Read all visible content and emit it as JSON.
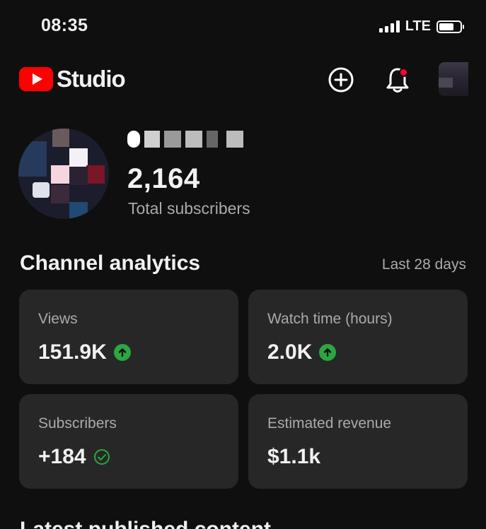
{
  "status_bar": {
    "time": "08:35",
    "network": "LTE"
  },
  "header": {
    "logo_text": "Studio",
    "icons": [
      "youtube-play-icon",
      "create-plus-icon",
      "bell-icon",
      "account-avatar"
    ],
    "accent_color": "#ff0000"
  },
  "channel": {
    "subscriber_count": "2,164",
    "subscriber_label": "Total subscribers"
  },
  "analytics": {
    "title": "Channel analytics",
    "range": "Last 28 days",
    "cards": [
      {
        "label": "Views",
        "value": "151.9K",
        "indicator": "up-arrow-icon"
      },
      {
        "label": "Watch time (hours)",
        "value": "2.0K",
        "indicator": "up-arrow-icon"
      },
      {
        "label": "Subscribers",
        "value": "+184",
        "indicator": "check-circle-icon"
      },
      {
        "label": "Estimated revenue",
        "value": "$1.1k",
        "indicator": ""
      }
    ],
    "positive_color": "#2ba640"
  },
  "latest": {
    "title": "Latest published content"
  }
}
